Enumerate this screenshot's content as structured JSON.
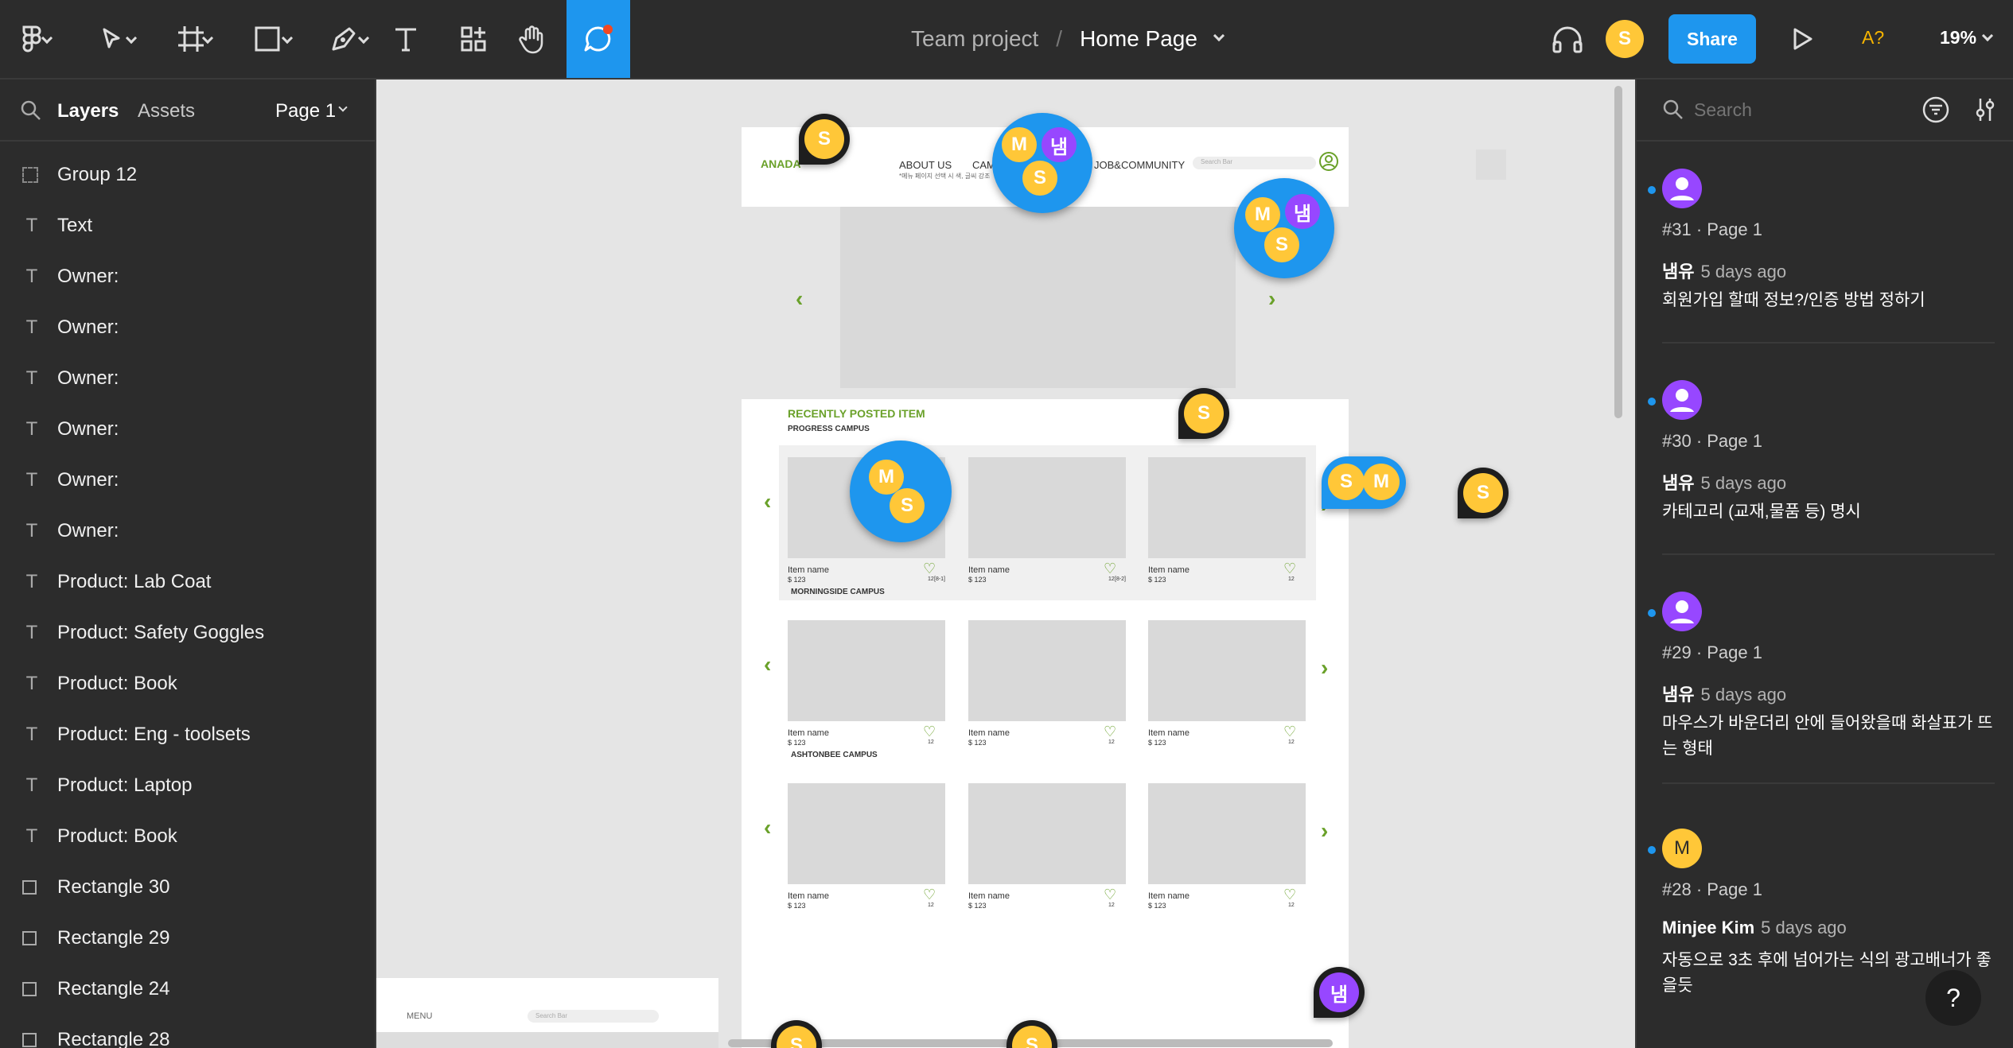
{
  "toolbar": {
    "title_team": "Team project",
    "title_sep": "/",
    "title_page": "Home Page",
    "user_initial": "S",
    "share_label": "Share",
    "font_missing_label": "A?",
    "zoom_label": "19%"
  },
  "left_panel": {
    "tabs": {
      "layers": "Layers",
      "assets": "Assets",
      "page": "Page 1"
    },
    "layers": [
      {
        "icon": "group-icon",
        "label": "Group 12"
      },
      {
        "icon": "text-icon",
        "label": "Text"
      },
      {
        "icon": "text-icon",
        "label": "Owner:"
      },
      {
        "icon": "text-icon",
        "label": "Owner:"
      },
      {
        "icon": "text-icon",
        "label": "Owner:"
      },
      {
        "icon": "text-icon",
        "label": "Owner:"
      },
      {
        "icon": "text-icon",
        "label": "Owner:"
      },
      {
        "icon": "text-icon",
        "label": "Owner:"
      },
      {
        "icon": "text-icon",
        "label": "Product: Lab Coat"
      },
      {
        "icon": "text-icon",
        "label": "Product: Safety Goggles"
      },
      {
        "icon": "text-icon",
        "label": "Product: Book"
      },
      {
        "icon": "text-icon",
        "label": "Product: Eng - toolsets"
      },
      {
        "icon": "text-icon",
        "label": "Product: Laptop"
      },
      {
        "icon": "text-icon",
        "label": "Product: Book"
      },
      {
        "icon": "rectangle-icon",
        "label": "Rectangle 30"
      },
      {
        "icon": "rectangle-icon",
        "label": "Rectangle 29"
      },
      {
        "icon": "rectangle-icon",
        "label": "Rectangle 24"
      },
      {
        "icon": "rectangle-icon",
        "label": "Rectangle 28"
      }
    ]
  },
  "canvas": {
    "logo": "ANADA",
    "nav": {
      "about": "ABOUT US",
      "cam": "CAM",
      "job": "JOB&COMMUNITY",
      "sub": "*메뉴 페이지 선택 시 색, 글씨 강조",
      "search": "Search Bar"
    },
    "section_title": "RECENTLY POSTED ITEM",
    "campuses": [
      "PROGRESS CAMPUS",
      "MORNINGSIDE CAMPUS",
      "ASHTONBEE CAMPUS"
    ],
    "item_name": "Item name",
    "item_price": "$ 123",
    "like_count": "12",
    "progress_notes": [
      "[8-1]",
      "[8-2]"
    ],
    "menu_frame": {
      "menu": "MENU",
      "search": "Search Bar"
    },
    "avatars": {
      "s": "S",
      "m": "M",
      "nam": "냄"
    }
  },
  "right_panel": {
    "search_placeholder": "Search",
    "comments": [
      {
        "avatar": "",
        "meta": "#31 · Page 1",
        "author": "냄유",
        "time": "5 days ago",
        "text": "회원가입 할때 정보?/인증 방법 정하기"
      },
      {
        "avatar": "",
        "meta": "#30 · Page 1",
        "author": "냄유",
        "time": "5 days ago",
        "text": "카테고리 (교재,물품 등) 명시"
      },
      {
        "avatar": "",
        "meta": "#29 · Page 1",
        "author": "냄유",
        "time": "5 days ago",
        "text": "마우스가 바운더리 안에 들어왔을때 화살표가 뜨는 형태"
      },
      {
        "avatar": "M",
        "meta": "#28 · Page 1",
        "author": "Minjee Kim",
        "time": "5 days ago",
        "text": "자동으로 3초 후에 넘어가는 식의 광고배너가 좋을듯"
      }
    ],
    "help_label": "?"
  },
  "colors": {
    "accent": "#1e96ee",
    "panel": "#2c2c2c",
    "canvas": "#e5e5e5",
    "brand_green": "#6aa12a",
    "avatar_yellow": "#ffc738",
    "avatar_purple": "#9747ff"
  }
}
